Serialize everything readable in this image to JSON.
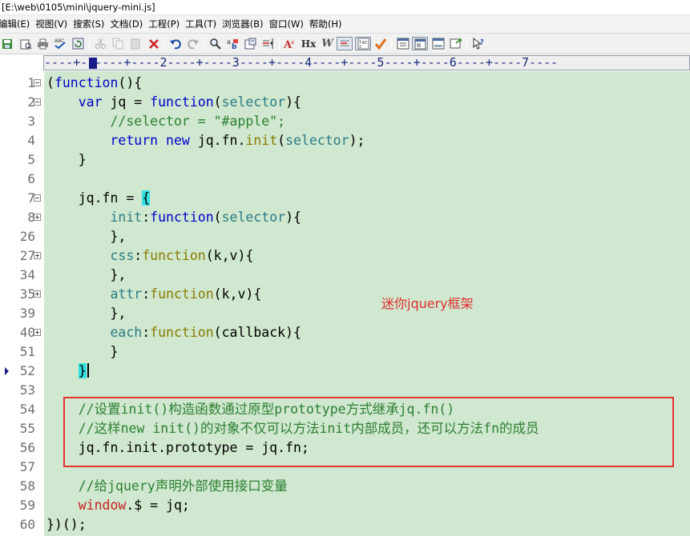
{
  "window": {
    "title": "[E:\\web\\0105\\mini\\jquery-mini.js]"
  },
  "menu": {
    "items": [
      {
        "label": "编辑(E)"
      },
      {
        "label": "视图(V)"
      },
      {
        "label": "搜索(S)"
      },
      {
        "label": "文档(D)"
      },
      {
        "label": "工程(P)"
      },
      {
        "label": "工具(T)"
      },
      {
        "label": "浏览器(B)"
      },
      {
        "label": "窗口(W)"
      },
      {
        "label": "帮助(H)"
      }
    ]
  },
  "toolbar": {
    "buttons": [
      "save-icon",
      "print-preview-icon",
      "print-icon",
      "spell-check-icon",
      "refresh-icon",
      "cut-icon",
      "copy-icon",
      "paste-icon",
      "delete-icon",
      "undo-icon",
      "redo-icon",
      "find-icon",
      "replace-icon",
      "find-in-files-icon",
      "goto-line-icon",
      "font-size-icon",
      "hex-view-icon",
      "word-wrap-icon",
      "show-spaces-icon",
      "line-numbers-icon",
      "spell-check-mark-icon",
      "column-mode-icon",
      "full-screen-icon",
      "output-window-icon",
      "browser-preview-icon",
      "help-pointer-icon"
    ],
    "hex_label": "Hx",
    "w_label": "W",
    "abc_label": "ABC",
    "a_label": "A"
  },
  "ruler": {
    "text": "----+-1----+----2----+----3----+----4----+----5----+----6----+----7----"
  },
  "editor": {
    "lines": [
      {
        "num": "1"
      },
      {
        "num": "2"
      },
      {
        "num": "3"
      },
      {
        "num": "4"
      },
      {
        "num": "5"
      },
      {
        "num": "6"
      },
      {
        "num": "7"
      },
      {
        "num": "8"
      },
      {
        "num": "26"
      },
      {
        "num": "27"
      },
      {
        "num": "34"
      },
      {
        "num": "35"
      },
      {
        "num": "39"
      },
      {
        "num": "40"
      },
      {
        "num": "51"
      },
      {
        "num": "52"
      },
      {
        "num": "53"
      },
      {
        "num": "54"
      },
      {
        "num": "55"
      },
      {
        "num": "56"
      },
      {
        "num": "57"
      },
      {
        "num": "58"
      },
      {
        "num": "59"
      },
      {
        "num": "60"
      }
    ],
    "code": {
      "l1_open": "(",
      "l1_kw": "function",
      "l1_rest": "(){",
      "l2_indent": "    ",
      "l2_var": "var",
      "l2_mid": " jq = ",
      "l2_kw": "function",
      "l2_paren_open": "(",
      "l2_param": "selector",
      "l2_paren_close": "){",
      "l3": "        //selector = \"#apple\";",
      "l4_indent": "        ",
      "l4_return": "return",
      "l4_sp": " ",
      "l4_new": "new",
      "l4_mid": " jq.fn.",
      "l4_init": "init",
      "l4_open": "(",
      "l4_param": "selector",
      "l4_close": ");",
      "l5": "    }",
      "l6": "",
      "l7_pre": "    jq.fn = ",
      "l7_brace": "{",
      "l8_indent": "        ",
      "l8_prop": "init",
      "l8_colon": ":",
      "l8_kw": "function",
      "l8_open": "(",
      "l8_param": "selector",
      "l8_close": "){",
      "l26": "        },",
      "l27_indent": "        ",
      "l27_prop": "css",
      "l27_colon": ":",
      "l27_kw": "function",
      "l27_args": "(k,v){",
      "l34": "        },",
      "l35_indent": "        ",
      "l35_prop": "attr",
      "l35_colon": ":",
      "l35_kw": "function",
      "l35_args": "(k,v){",
      "l39": "        },",
      "l40_indent": "        ",
      "l40_prop": "each",
      "l40_colon": ":",
      "l40_kw": "function",
      "l40_args": "(callback){",
      "l51": "        }",
      "l52_indent": "    ",
      "l52_brace": "}",
      "l53": "",
      "l54": "    //设置init()构造函数通过原型prototype方式继承jq.fn()",
      "l55": "    //这样new init()的对象不仅可以方法init内部成员，还可以方法fn的成员",
      "l56": "    jq.fn.init.prototype = jq.fn;",
      "l57": "",
      "l58": "    //给jquery声明外部使用接口变量",
      "l59_indent": "    ",
      "l59_win": "window",
      "l59_rest": ".$ = jq;",
      "l60": "})();"
    },
    "annotation": "迷你jquery框架"
  },
  "colors": {
    "code_background": "#cfe8cf",
    "keyword": "#0000cc",
    "comment": "#2e7f32",
    "highlight_box": "#e83232",
    "annotation": "#e03030"
  }
}
